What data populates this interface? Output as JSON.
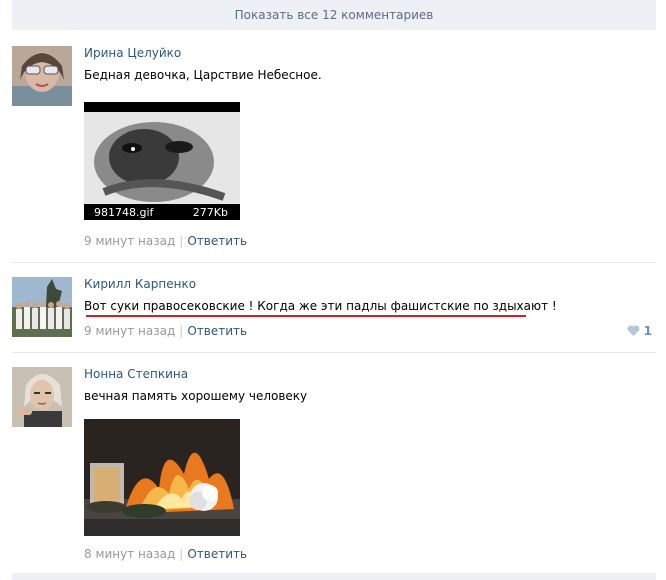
{
  "show_all": {
    "label": "Показать все 12 комментариев"
  },
  "comments": [
    {
      "author": "Ирина Целуйко",
      "text": "Бедная девочка, Царствие Небесное.",
      "attachment": {
        "type": "gif",
        "filename": "981748.gif",
        "size": "277Kb"
      },
      "time": "9 минут назад",
      "reply_label": "Ответить"
    },
    {
      "author": "Кирилл Карпенко",
      "text": "Вот суки правосековские ! Когда же эти падлы фашистские по здыхают !",
      "time": "9 минут назад",
      "reply_label": "Ответить",
      "likes": "1",
      "highlight_color": "#d0202a"
    },
    {
      "author": "Нонна Степкина",
      "text": "вечная память хорошему человеку",
      "attachment": {
        "type": "photo"
      },
      "time": "8 минут назад",
      "reply_label": "Ответить"
    }
  ],
  "colors": {
    "link": "#2b587a",
    "muted": "#999999",
    "bar": "#edf0f4",
    "like": "#9cb2c6"
  }
}
